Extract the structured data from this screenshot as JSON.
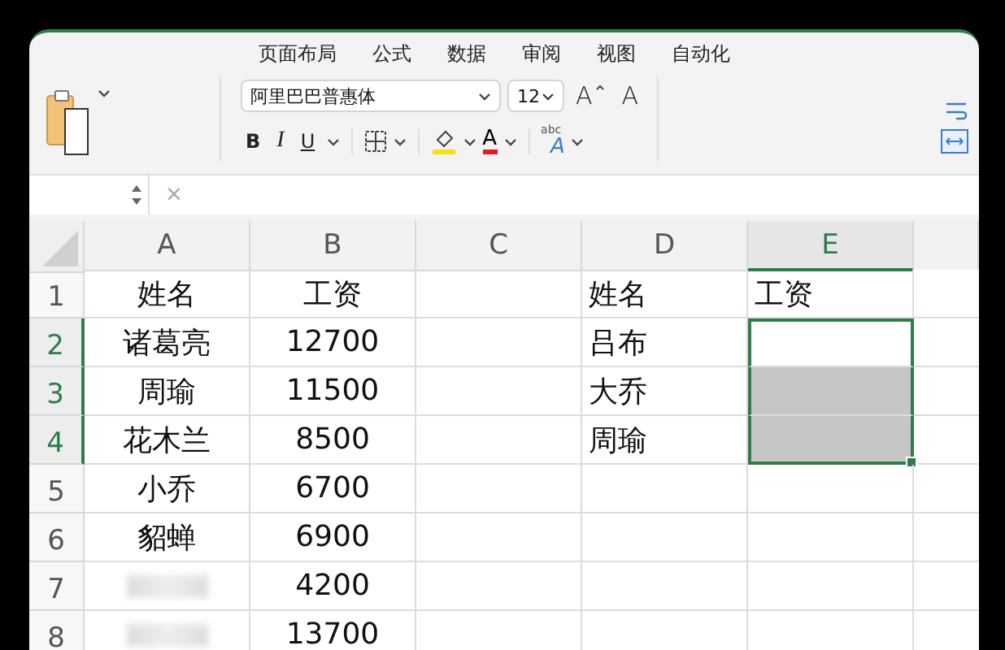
{
  "menu_tabs": [
    {
      "label": "页面布局",
      "selected": false
    },
    {
      "label": "公式",
      "selected": false
    },
    {
      "label": "数据",
      "selected": false
    },
    {
      "label": "审阅",
      "selected": false
    },
    {
      "label": "视图",
      "selected": false
    },
    {
      "label": "自动化",
      "selected": false
    }
  ],
  "ribbon": {
    "font_name": "阿里巴巴普惠体",
    "font_size": "12",
    "grow_font": "A",
    "shrink_font": "A",
    "bold": "B",
    "italic": "I",
    "underline": "U",
    "font_color": "A",
    "text_effects_small": "abc",
    "text_effects_large": "A"
  },
  "formula_bar": {
    "cancel": "×"
  },
  "columns": [
    {
      "label": "A",
      "selected": false
    },
    {
      "label": "B",
      "selected": false
    },
    {
      "label": "C",
      "selected": false
    },
    {
      "label": "D",
      "selected": false
    },
    {
      "label": "E",
      "selected": true
    }
  ],
  "rows": [
    {
      "number": "1",
      "selected": false,
      "cells": [
        {
          "text": "姓名",
          "selected": false
        },
        {
          "text": "工资",
          "selected": false
        },
        {
          "text": "",
          "selected": false
        },
        {
          "text": "姓名",
          "selected": false
        },
        {
          "text": "工资",
          "selected": false
        }
      ]
    },
    {
      "number": "2",
      "selected": true,
      "cells": [
        {
          "text": "诸葛亮",
          "selected": false
        },
        {
          "text": "12700",
          "selected": false
        },
        {
          "text": "",
          "selected": false
        },
        {
          "text": "吕布",
          "selected": false
        },
        {
          "text": "",
          "selected": true,
          "active": true
        }
      ]
    },
    {
      "number": "3",
      "selected": true,
      "cells": [
        {
          "text": "周瑜",
          "selected": false
        },
        {
          "text": "11500",
          "selected": false
        },
        {
          "text": "",
          "selected": false
        },
        {
          "text": "大乔",
          "selected": false
        },
        {
          "text": "",
          "selected": true,
          "active": false
        }
      ]
    },
    {
      "number": "4",
      "selected": true,
      "cells": [
        {
          "text": "花木兰",
          "selected": false
        },
        {
          "text": "8500",
          "selected": false
        },
        {
          "text": "",
          "selected": false
        },
        {
          "text": "周瑜",
          "selected": false
        },
        {
          "text": "",
          "selected": true,
          "active": false
        }
      ]
    },
    {
      "number": "5",
      "selected": false,
      "cells": [
        {
          "text": "小乔",
          "selected": false
        },
        {
          "text": "6700",
          "selected": false
        },
        {
          "text": "",
          "selected": false
        },
        {
          "text": "",
          "selected": false
        },
        {
          "text": "",
          "selected": false
        }
      ]
    },
    {
      "number": "6",
      "selected": false,
      "cells": [
        {
          "text": "貂蝉",
          "selected": false
        },
        {
          "text": "6900",
          "selected": false
        },
        {
          "text": "",
          "selected": false
        },
        {
          "text": "",
          "selected": false
        },
        {
          "text": "",
          "selected": false
        }
      ]
    },
    {
      "number": "7",
      "selected": false,
      "cells": [
        {
          "text": "",
          "selected": false,
          "blurred": true
        },
        {
          "text": "4200",
          "selected": false
        },
        {
          "text": "",
          "selected": false
        },
        {
          "text": "",
          "selected": false
        },
        {
          "text": "",
          "selected": false
        }
      ]
    },
    {
      "number": "8",
      "selected": false,
      "cells": [
        {
          "text": "",
          "selected": false,
          "blurred": true
        },
        {
          "text": "13700",
          "selected": false
        },
        {
          "text": "",
          "selected": false
        },
        {
          "text": "",
          "selected": false
        },
        {
          "text": "",
          "selected": false
        }
      ]
    }
  ]
}
